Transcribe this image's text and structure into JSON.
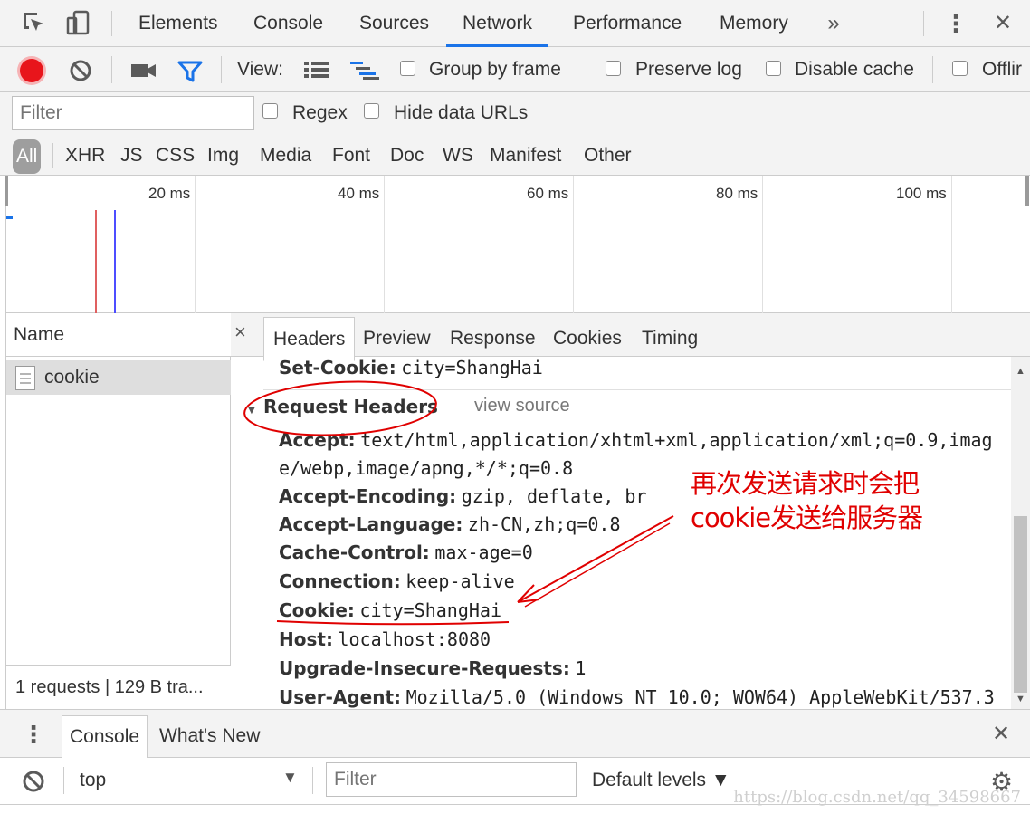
{
  "top_tabs": [
    "Elements",
    "Console",
    "Sources",
    "Network",
    "Performance",
    "Memory"
  ],
  "top_more": "»",
  "top_menu": "⋮",
  "top_close": "✕",
  "toolbar": {
    "view_label": "View:",
    "group_by_frame": "Group by frame",
    "preserve_log": "Preserve log",
    "disable_cache": "Disable cache",
    "offline": "Offlir"
  },
  "filter": {
    "placeholder": "Filter",
    "regex": "Regex",
    "hide_data_urls": "Hide data URLs"
  },
  "types": [
    "All",
    "XHR",
    "JS",
    "CSS",
    "Img",
    "Media",
    "Font",
    "Doc",
    "WS",
    "Manifest",
    "Other"
  ],
  "timeline": {
    "labels": [
      "20 ms",
      "40 ms",
      "60 ms",
      "80 ms",
      "100 ms"
    ],
    "dom_content_loaded_ms": 9.4,
    "load_ms": 11.4
  },
  "name_panel": {
    "header": "Name",
    "rows": [
      "cookie"
    ],
    "status": "1 requests  |  129 B tra..."
  },
  "detail_tabs": [
    "Headers",
    "Preview",
    "Response",
    "Cookies",
    "Timing"
  ],
  "detail_close": "×",
  "headers": {
    "set_cookie_key": "Set-Cookie:",
    "set_cookie_val": "city=ShangHai",
    "section_title": "Request Headers",
    "view_source": "view source",
    "rows": [
      {
        "key": "Accept:",
        "val": "text/html,application/xhtml+xml,application/xml;q=0.9,imag"
      },
      {
        "key": "",
        "val": "e/webp,image/apng,*/*;q=0.8"
      },
      {
        "key": "Accept-Encoding:",
        "val": "gzip, deflate, br"
      },
      {
        "key": "Accept-Language:",
        "val": "zh-CN,zh;q=0.8"
      },
      {
        "key": "Cache-Control:",
        "val": "max-age=0"
      },
      {
        "key": "Connection:",
        "val": "keep-alive"
      },
      {
        "key": "Cookie:",
        "val": "city=ShangHai"
      },
      {
        "key": "Host:",
        "val": "localhost:8080"
      },
      {
        "key": "Upgrade-Insecure-Requests:",
        "val": "1"
      },
      {
        "key": "User-Agent:",
        "val": "Mozilla/5.0 (Windows NT 10.0; WOW64) AppleWebKit/537.3"
      }
    ]
  },
  "annotation": {
    "line1": "再次发送请求时会把",
    "line2": "cookie发送给服务器"
  },
  "drawer": {
    "tabs": [
      "Console",
      "What's New"
    ],
    "close": "✕",
    "context": "top",
    "filter_placeholder": "Filter",
    "levels": "Default levels ▼"
  },
  "watermark": "https://blog.csdn.net/qq_34598667",
  "colors": {
    "accent": "#1a73e8",
    "record": "#e8151b",
    "filter_icon": "#1a73e8",
    "annotation": "#e00000",
    "dcl_line": "#4d4dff",
    "load_line": "#e06060"
  }
}
